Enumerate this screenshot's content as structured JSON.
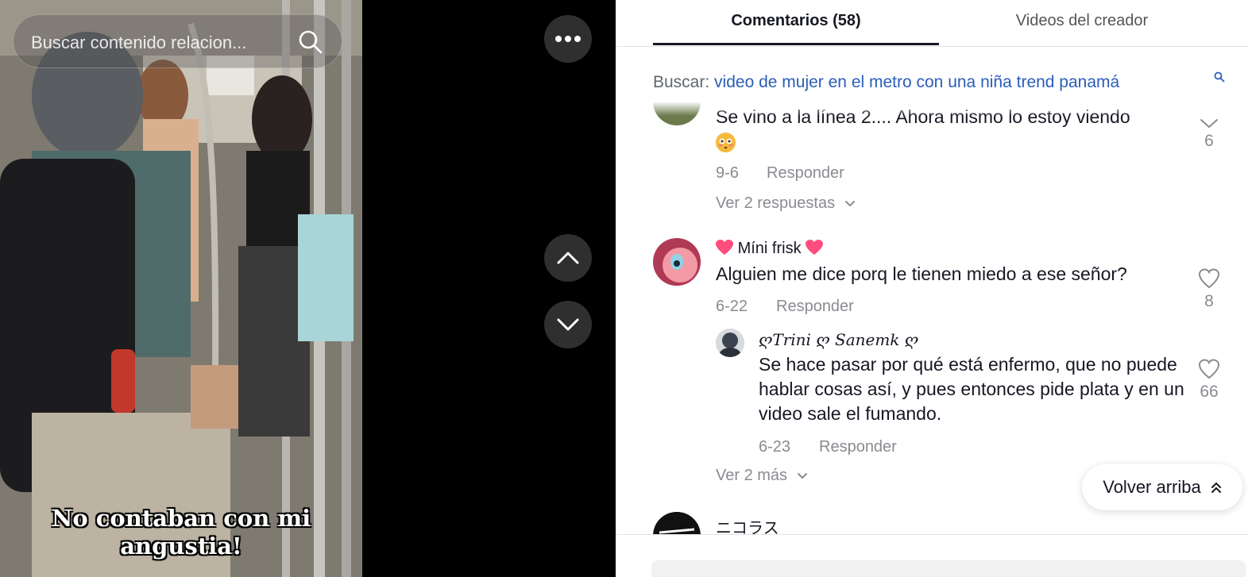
{
  "video": {
    "search_placeholder": "Buscar contenido relacion...",
    "caption_line1": "No contaban con mi",
    "caption_line2": "angustia!"
  },
  "tabs": [
    {
      "label": "Comentarios (58)",
      "active": true
    },
    {
      "label": "Videos del creador",
      "active": false
    }
  ],
  "related_search": {
    "label": "Buscar:",
    "query": "video de mujer en el metro con una niña trend panamá"
  },
  "comments": [
    {
      "text": "Se vino a la línea 2.... Ahora mismo lo estoy viendo",
      "emoji": "flushed-face",
      "date": "9-6",
      "reply_label": "Responder",
      "likes": "6",
      "view_replies": "Ver 2 respuestas"
    },
    {
      "username": "Míni frisk",
      "text": "Alguien me dice porq le tienen miedo a ese señor?",
      "date": "6-22",
      "reply_label": "Responder",
      "likes": "8",
      "reply": {
        "username": "ღTrini ღ Sanemk ღ",
        "text": "Se hace pasar por qué está enfermo, que no puede hablar cosas así, y pues entonces pide plata y en un video sale el fumando.",
        "date": "6-23",
        "reply_label": "Responder",
        "likes": "66"
      },
      "view_more": "Ver 2 más"
    },
    {
      "username": "ニコラス"
    }
  ],
  "back_to_top": "Volver arriba",
  "colors": {
    "accent_link": "#2b5db9",
    "text_primary": "#161823",
    "text_secondary": "#8a8b91",
    "heart_emoji": "#ff4d7d"
  }
}
